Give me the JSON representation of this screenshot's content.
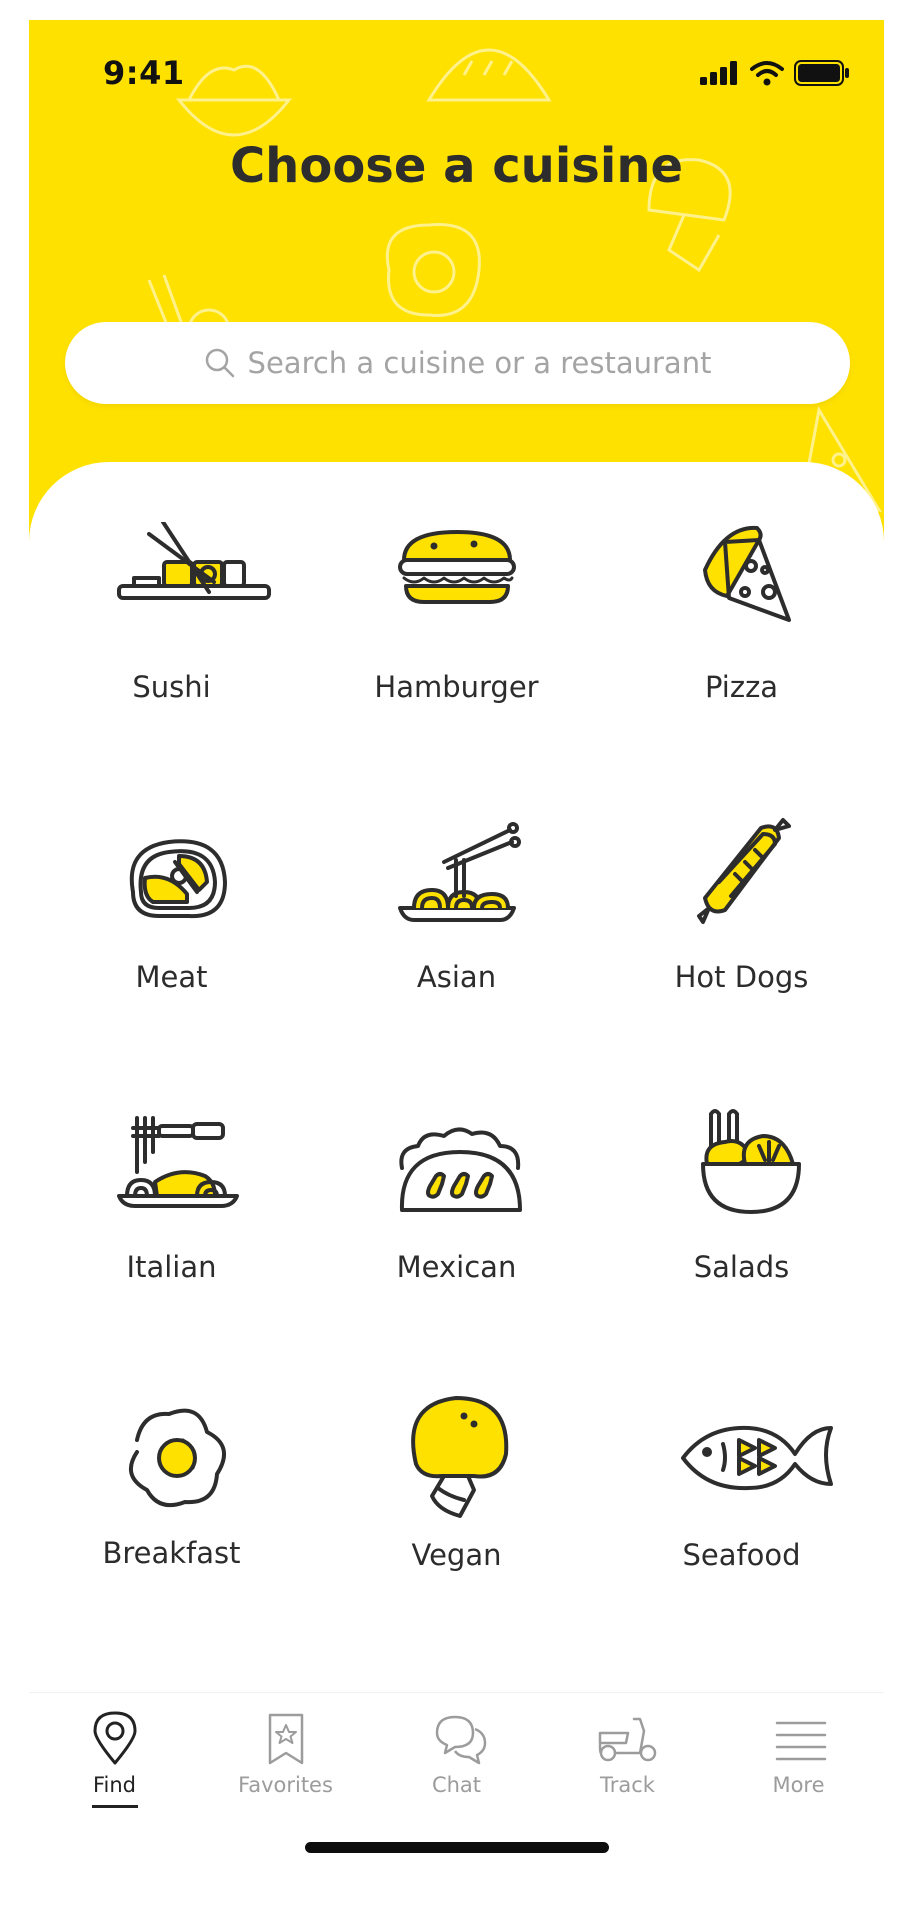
{
  "status_bar": {
    "time": "9:41"
  },
  "header": {
    "title": "Choose a cuisine"
  },
  "search": {
    "placeholder": "Search a cuisine or a restaurant"
  },
  "cuisines": [
    {
      "label": "Sushi",
      "icon": "sushi-icon"
    },
    {
      "label": "Hamburger",
      "icon": "hamburger-icon"
    },
    {
      "label": "Pizza",
      "icon": "pizza-icon"
    },
    {
      "label": "Meat",
      "icon": "steak-icon"
    },
    {
      "label": "Asian",
      "icon": "noodles-icon"
    },
    {
      "label": "Hot Dogs",
      "icon": "sausage-icon"
    },
    {
      "label": "Italian",
      "icon": "spaghetti-icon"
    },
    {
      "label": "Mexican",
      "icon": "taco-icon"
    },
    {
      "label": "Salads",
      "icon": "salad-bowl-icon"
    },
    {
      "label": "Breakfast",
      "icon": "fried-egg-icon"
    },
    {
      "label": "Vegan",
      "icon": "mushroom-icon"
    },
    {
      "label": "Seafood",
      "icon": "fish-icon"
    }
  ],
  "tabbar": {
    "items": [
      {
        "label": "Find",
        "icon": "map-pin-icon",
        "active": true
      },
      {
        "label": "Favorites",
        "icon": "bookmark-star-icon",
        "active": false
      },
      {
        "label": "Chat",
        "icon": "chat-bubbles-icon",
        "active": false
      },
      {
        "label": "Track",
        "icon": "scooter-icon",
        "active": false
      },
      {
        "label": "More",
        "icon": "menu-lines-icon",
        "active": false
      }
    ]
  },
  "colors": {
    "brand_yellow": "#FFE100",
    "ink": "#2D2D2D",
    "muted": "#9C9C9C"
  }
}
